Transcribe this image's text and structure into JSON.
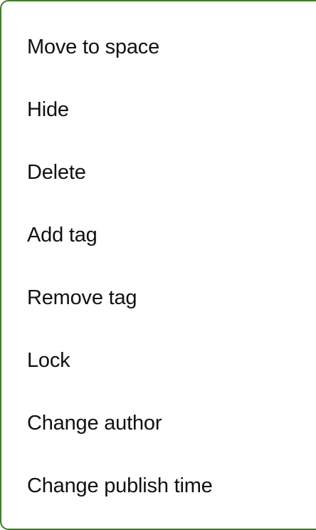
{
  "menu": {
    "items": [
      {
        "label": "Move to space"
      },
      {
        "label": "Hide"
      },
      {
        "label": "Delete"
      },
      {
        "label": "Add tag"
      },
      {
        "label": "Remove tag"
      },
      {
        "label": "Lock"
      },
      {
        "label": "Change author"
      },
      {
        "label": "Change publish time"
      }
    ]
  },
  "colors": {
    "border": "#3f7d2a",
    "text": "#111111",
    "background": "#ffffff"
  }
}
